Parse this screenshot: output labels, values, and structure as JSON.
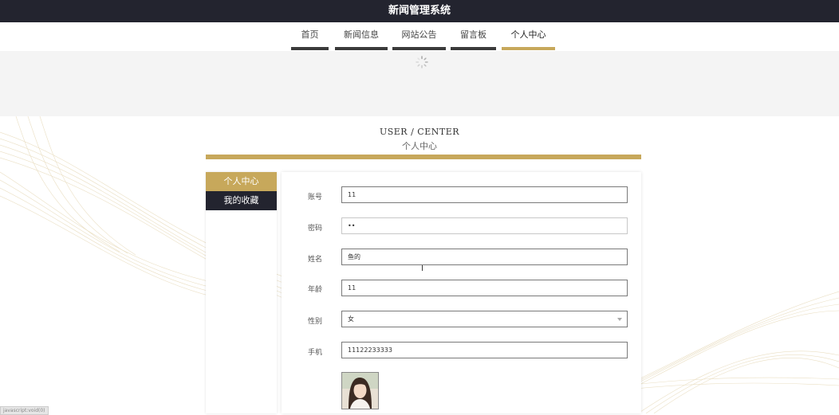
{
  "app_title": "新闻管理系统",
  "nav": {
    "items": [
      {
        "label": "首页"
      },
      {
        "label": "新闻信息"
      },
      {
        "label": "网站公告"
      },
      {
        "label": "留言板"
      },
      {
        "label": "个人中心"
      }
    ],
    "active_index": 4
  },
  "section": {
    "title_en": "USER / CENTER",
    "title_cn": "个人中心"
  },
  "sidebar": {
    "items": [
      {
        "label": "个人中心"
      },
      {
        "label": "我的收藏"
      }
    ]
  },
  "form": {
    "fields": [
      {
        "label": "账号",
        "value": "11"
      },
      {
        "label": "密码",
        "value": "••"
      },
      {
        "label": "姓名",
        "value": "鱼的"
      },
      {
        "label": "年龄",
        "value": "11"
      },
      {
        "label": "性别",
        "value": "女"
      },
      {
        "label": "手机",
        "value": "11122233333"
      }
    ]
  },
  "status_tip": "javascript:void(0)",
  "colors": {
    "accent": "#c7a85b",
    "dark": "#23242f"
  },
  "icons": [
    "loading-spinner-icon",
    "chevron-down-icon",
    "text-cursor-icon"
  ]
}
